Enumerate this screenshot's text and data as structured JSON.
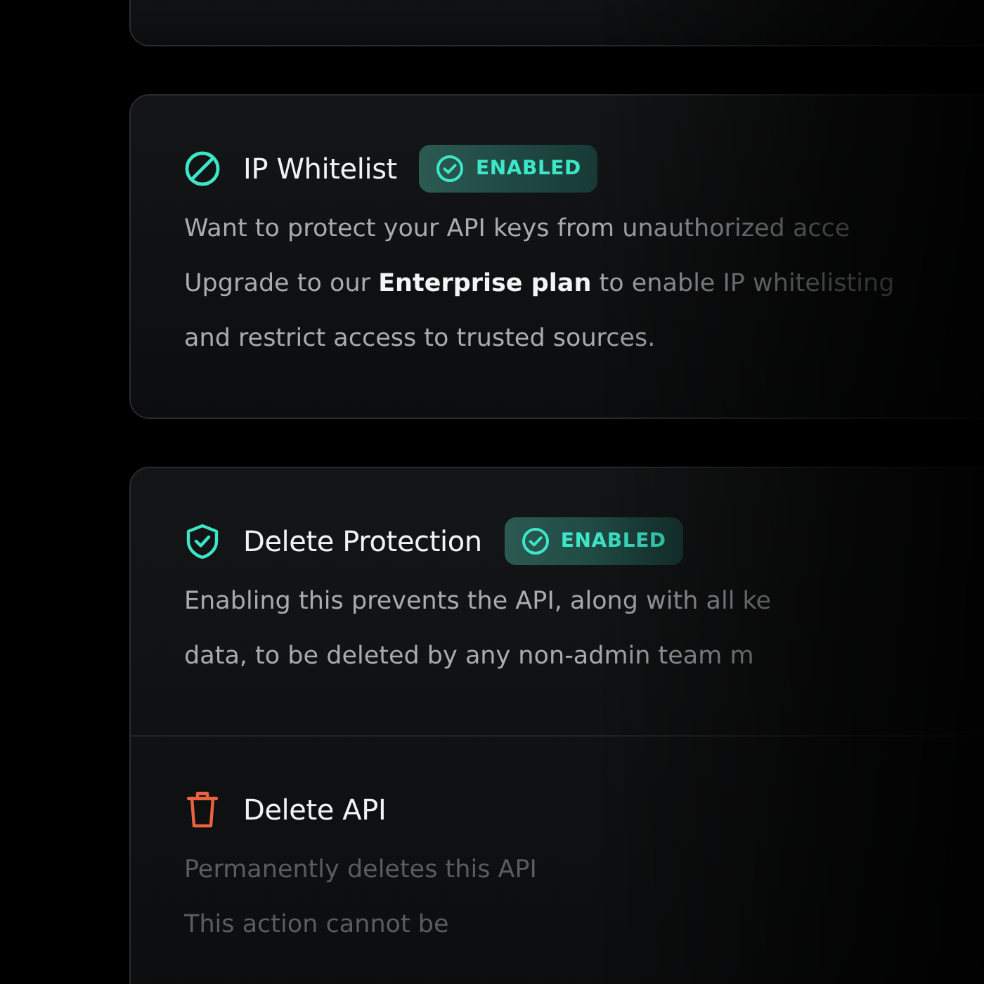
{
  "cards": [
    {
      "kind": "partial"
    },
    {
      "kind": "full",
      "sections": [
        {
          "kind": "whitelist",
          "title": "IP Whitelist",
          "badge": "ENABLED",
          "description": "Want to protect your API keys from unauthorized acce\nUpgrade to our **Enterprise plan** to enable IP whitelisting\nand restrict access to trusted sources."
        }
      ]
    },
    {
      "kind": "full",
      "sections": [
        {
          "kind": "protection",
          "title": "Delete Protection",
          "badge": "ENABLED",
          "description": "Enabling this prevents the API, along with all ke\ndata, to be deleted by any non-admin team m"
        },
        {
          "kind": "danger",
          "title": "Delete API",
          "description": "Permanently deletes this API\nThis action cannot be"
        }
      ]
    }
  ]
}
